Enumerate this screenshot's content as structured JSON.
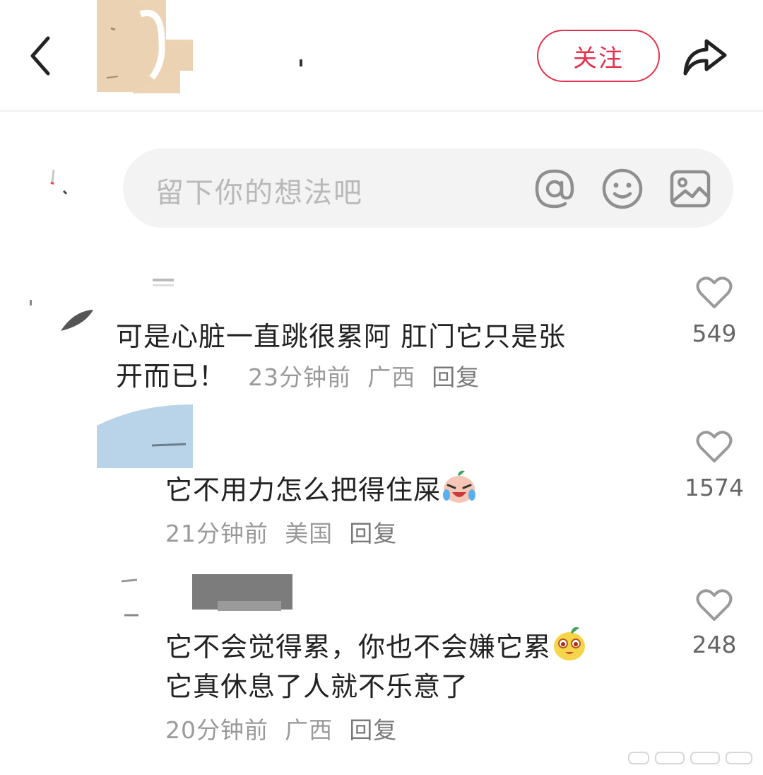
{
  "header": {
    "follow_label": "关注",
    "icons": {
      "back": "chevron-left-icon",
      "share": "share-icon"
    }
  },
  "comment_input": {
    "placeholder": "留下你的想法吧",
    "icons": [
      "at-icon",
      "emoji-smile-icon",
      "image-icon"
    ]
  },
  "comments": [
    {
      "text_line1": "可是心脏一直跳很累阿 肛门它只是张",
      "text_line2": "开而已！",
      "time": "23分钟前",
      "location": "广西",
      "reply": "回复",
      "likes": "549"
    },
    {
      "text": "它不用力怎么把得住屎",
      "emoji": "crying-laughing-emoji",
      "time": "21分钟前",
      "location": "美国",
      "reply": "回复",
      "likes": "1574"
    },
    {
      "text_line1": "它不会觉得累，你也不会嫌它累",
      "emoji": "yellow-creature-emoji",
      "text_line2": "它真休息了人就不乐意了",
      "time": "20分钟前",
      "location": "广西",
      "reply": "回复",
      "likes": "248"
    }
  ],
  "colors": {
    "accent": "#e5314d",
    "placeholder": "#b9b9b9",
    "input_bg": "#f3f3f3"
  }
}
